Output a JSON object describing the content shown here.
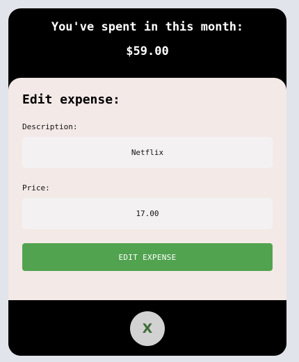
{
  "header": {
    "title": "You've spent in this month:",
    "total": "$59.00"
  },
  "form": {
    "title": "Edit expense:",
    "description_label": "Description:",
    "description_value": "Netflix",
    "price_label": "Price:",
    "price_value": "17.00",
    "submit_label": "EDIT EXPENSE"
  },
  "footer": {
    "close_label": "X"
  },
  "colors": {
    "background": "#e1e4ea",
    "app": "#000000",
    "card": "#f3e9e7",
    "input": "#f4f1f3",
    "accent_green": "#52a350",
    "close_button": "#d2d2d2",
    "close_glyph": "#3d6e38"
  }
}
